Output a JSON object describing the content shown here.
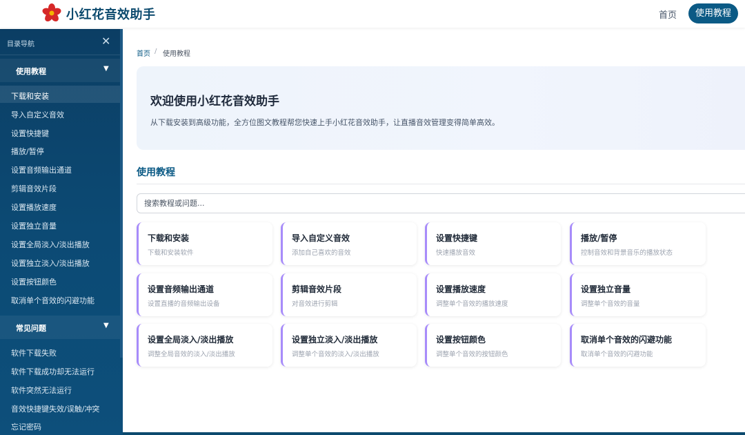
{
  "header": {
    "brand": "小红花音效助手",
    "nav_home": "首页",
    "nav_tutorial": "使用教程",
    "logo_icon": "red-flower-icon",
    "accent_color": "#0b5a85"
  },
  "sidebar": {
    "title": "目录导航",
    "sections": [
      {
        "label": "使用教程",
        "items": [
          "下载和安装",
          "导入自定义音效",
          "设置快捷键",
          "播放/暂停",
          "设置音频输出通道",
          "剪辑音效片段",
          "设置播放速度",
          "设置独立音量",
          "设置全局淡入/淡出播放",
          "设置独立淡入/淡出播放",
          "设置按钮颜色",
          "取消单个音效的闪避功能"
        ]
      },
      {
        "label": "常见问题",
        "items": [
          "软件下载失败",
          "软件下载成功却无法运行",
          "软件突然无法运行",
          "音效快捷键失效/误触/冲突",
          "忘记密码"
        ]
      }
    ]
  },
  "main": {
    "breadcrumb": {
      "home": "首页",
      "separator": "/",
      "current": "使用教程"
    },
    "hero": {
      "title": "欢迎使用小红花音效助手",
      "description": "从下载安装到高级功能，全方位图文教程帮您快速上手小红花音效助手，让直播音效管理变得简单高效。"
    },
    "section_title": "使用教程",
    "search_placeholder": "搜索教程或问题...",
    "cards": [
      {
        "title": "下载和安装",
        "desc": "下载和安装软件"
      },
      {
        "title": "导入自定义音效",
        "desc": "添加自己喜欢的音效"
      },
      {
        "title": "设置快捷键",
        "desc": "快速播放音效"
      },
      {
        "title": "播放/暂停",
        "desc": "控制音效和背景音乐的播放状态"
      },
      {
        "title": "设置音频输出通道",
        "desc": "设置直播的音频输出设备"
      },
      {
        "title": "剪辑音效片段",
        "desc": "对音效进行剪辑"
      },
      {
        "title": "设置播放速度",
        "desc": "调整单个音效的播放速度"
      },
      {
        "title": "设置独立音量",
        "desc": "调整单个音效的音量"
      },
      {
        "title": "设置全局淡入/淡出播放",
        "desc": "调整全局音效的淡入/淡出播放"
      },
      {
        "title": "设置独立淡入/淡出播放",
        "desc": "调整单个音效的淡入/淡出播放"
      },
      {
        "title": "设置按钮颜色",
        "desc": "调整单个音效的按钮颜色"
      },
      {
        "title": "取消单个音效的闪避功能",
        "desc": "取消单个音效的闪避功能"
      }
    ]
  }
}
